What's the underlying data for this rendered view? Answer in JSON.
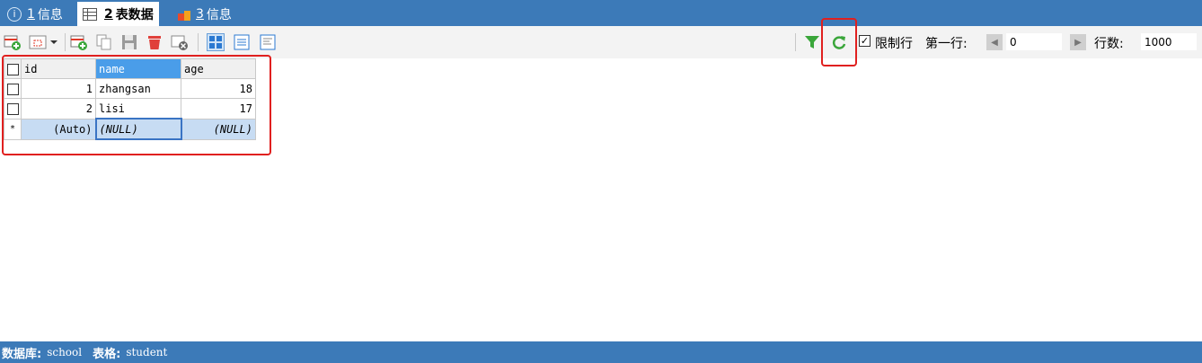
{
  "tabs": [
    {
      "num": "1",
      "label": "信息"
    },
    {
      "num": "2",
      "label": "表数据"
    },
    {
      "num": "3",
      "label": "信息"
    }
  ],
  "toolbar": {
    "limit_label": "限制行",
    "first_row_label": "第一行:",
    "first_row_value": "0",
    "row_count_label": "行数:",
    "row_count_value": "1000"
  },
  "grid": {
    "columns": [
      "id",
      "name",
      "age"
    ],
    "rows": [
      {
        "id": "1",
        "name": "zhangsan",
        "age": "18"
      },
      {
        "id": "2",
        "name": "lisi",
        "age": "17"
      }
    ],
    "new_row": {
      "marker": "*",
      "id": "(Auto)",
      "name": "(NULL)",
      "age": "(NULL)"
    }
  },
  "status": {
    "db_label": "数据库:",
    "db_value": "school",
    "table_label": "表格:",
    "table_value": "student"
  },
  "colors": {
    "accent": "#3c7ab8",
    "selected_header": "#4a9de9",
    "highlight": "#e0201f"
  }
}
